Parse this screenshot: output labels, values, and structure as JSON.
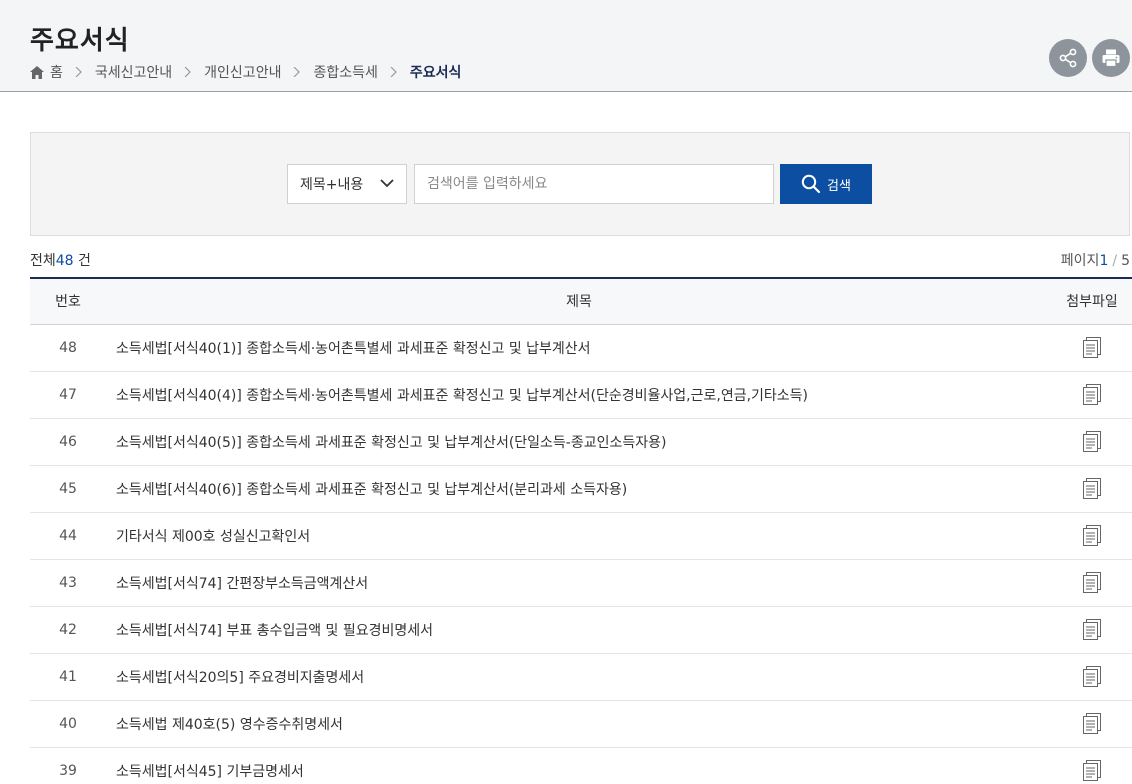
{
  "header": {
    "title": "주요서식",
    "breadcrumb": [
      "홈",
      "국세신고안내",
      "개인신고안내",
      "종합소득세",
      "주요서식"
    ]
  },
  "search": {
    "select_value": "제목+내용",
    "placeholder": "검색어를 입력하세요",
    "button_label": "검색"
  },
  "summary": {
    "total_prefix": "전체",
    "total_count": "48",
    "total_suffix": "건",
    "page_label": "페이지",
    "current_page": "1",
    "page_sep": "/",
    "total_pages": "5"
  },
  "table": {
    "headers": {
      "num": "번호",
      "title": "제목",
      "file": "첨부파일"
    },
    "rows": [
      {
        "num": "48",
        "title": "소득세법[서식40(1)] 종합소득세·농어촌특별세 과세표준 확정신고 및 납부계산서"
      },
      {
        "num": "47",
        "title": "소득세법[서식40(4)] 종합소득세·농어촌특별세 과세표준 확정신고 및 납부계산서(단순경비율사업,근로,연금,기타소득)"
      },
      {
        "num": "46",
        "title": "소득세법[서식40(5)] 종합소득세 과세표준 확정신고 및 납부계산서(단일소득-종교인소득자용)"
      },
      {
        "num": "45",
        "title": "소득세법[서식40(6)] 종합소득세 과세표준 확정신고 및 납부계산서(분리과세 소득자용)"
      },
      {
        "num": "44",
        "title": "기타서식 제00호 성실신고확인서"
      },
      {
        "num": "43",
        "title": "소득세법[서식74] 간편장부소득금액계산서"
      },
      {
        "num": "42",
        "title": "소득세법[서식74] 부표 총수입금액 및 필요경비명세서"
      },
      {
        "num": "41",
        "title": "소득세법[서식20의5] 주요경비지출명세서"
      },
      {
        "num": "40",
        "title": "소득세법 제40호(5) 영수증수취명세서"
      },
      {
        "num": "39",
        "title": "소득세법[서식45] 기부금명세서"
      }
    ]
  },
  "icons": {
    "home": "home-icon",
    "share": "share-icon",
    "print": "print-icon",
    "search": "search-icon",
    "attachment": "document-icon"
  },
  "colors": {
    "accent": "#0b4ea2",
    "header_bg": "#f4f5f7",
    "table_border": "#1a2c55"
  }
}
